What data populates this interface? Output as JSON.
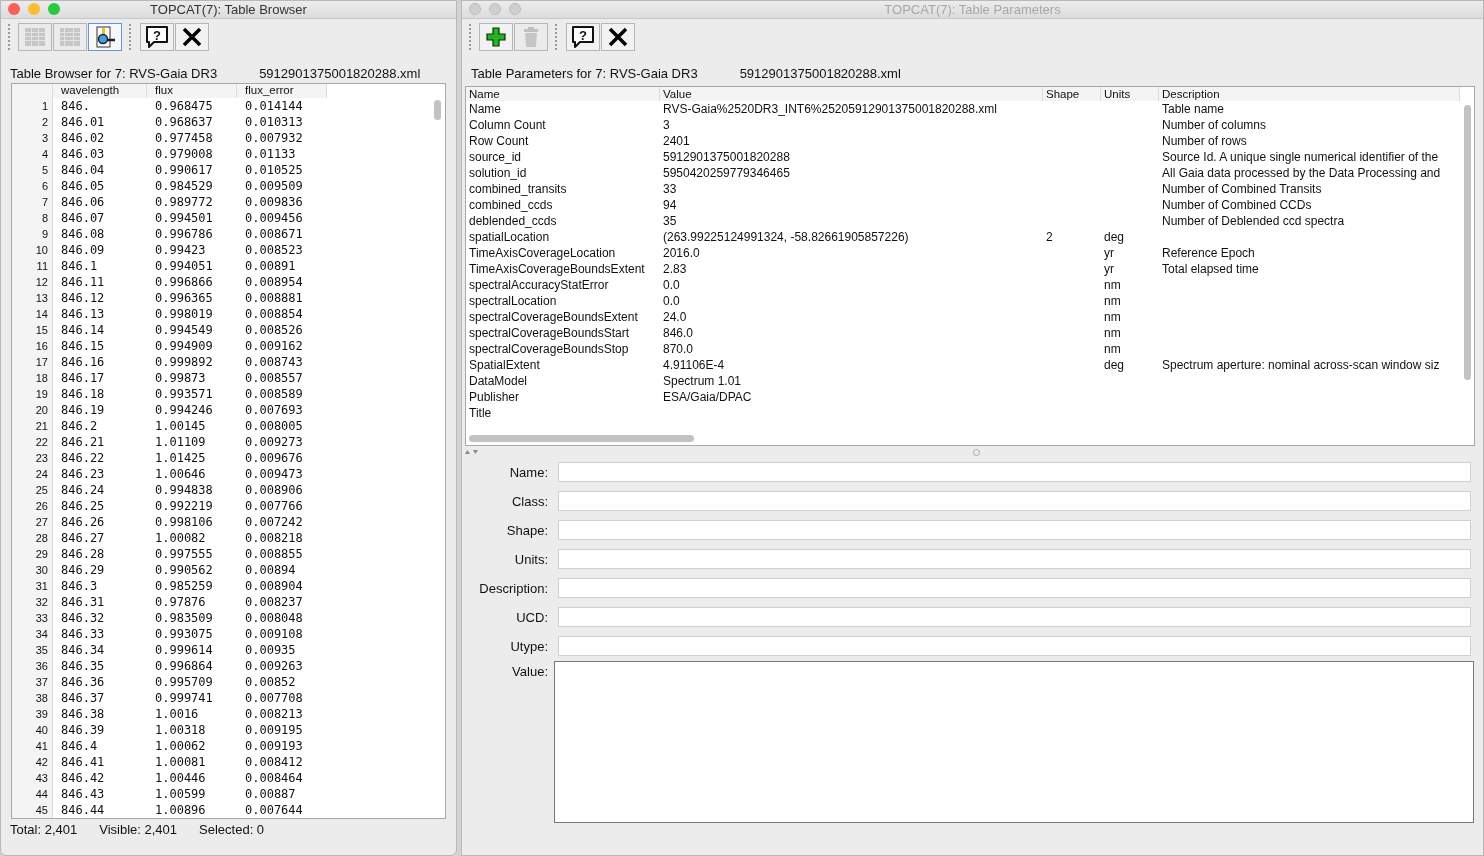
{
  "browser": {
    "window": {
      "title": "TOPCAT(7): Table Browser",
      "active": true
    },
    "toolbar": [
      [
        {
          "kind": "grid",
          "disabled": true,
          "selected": false
        },
        {
          "kind": "grid-alt",
          "disabled": true,
          "selected": false
        },
        {
          "kind": "search",
          "disabled": false,
          "selected": true
        }
      ],
      [
        {
          "kind": "help",
          "glyph": "?",
          "disabled": false,
          "selected": false
        },
        {
          "kind": "close",
          "disabled": false,
          "selected": false
        }
      ]
    ],
    "heading": "Table Browser for 7: RVS-Gaia DR3",
    "heading_file": "5912901375001820288.xml",
    "table": {
      "columns": [
        "",
        "wavelength",
        "flux",
        "flux_error"
      ],
      "rows": [
        [
          "1",
          "846.",
          "0.968475",
          "0.014144"
        ],
        [
          "2",
          "846.01",
          "0.968637",
          "0.010313"
        ],
        [
          "3",
          "846.02",
          "0.977458",
          "0.007932"
        ],
        [
          "4",
          "846.03",
          "0.979008",
          "0.01133"
        ],
        [
          "5",
          "846.04",
          "0.990617",
          "0.010525"
        ],
        [
          "6",
          "846.05",
          "0.984529",
          "0.009509"
        ],
        [
          "7",
          "846.06",
          "0.989772",
          "0.009836"
        ],
        [
          "8",
          "846.07",
          "0.994501",
          "0.009456"
        ],
        [
          "9",
          "846.08",
          "0.996786",
          "0.008671"
        ],
        [
          "10",
          "846.09",
          "0.99423",
          "0.008523"
        ],
        [
          "11",
          "846.1",
          "0.994051",
          "0.00891"
        ],
        [
          "12",
          "846.11",
          "0.996866",
          "0.008954"
        ],
        [
          "13",
          "846.12",
          "0.996365",
          "0.008881"
        ],
        [
          "14",
          "846.13",
          "0.998019",
          "0.008854"
        ],
        [
          "15",
          "846.14",
          "0.994549",
          "0.008526"
        ],
        [
          "16",
          "846.15",
          "0.994909",
          "0.009162"
        ],
        [
          "17",
          "846.16",
          "0.999892",
          "0.008743"
        ],
        [
          "18",
          "846.17",
          "0.99873",
          "0.008557"
        ],
        [
          "19",
          "846.18",
          "0.993571",
          "0.008589"
        ],
        [
          "20",
          "846.19",
          "0.994246",
          "0.007693"
        ],
        [
          "21",
          "846.2",
          "1.00145",
          "0.008005"
        ],
        [
          "22",
          "846.21",
          "1.01109",
          "0.009273"
        ],
        [
          "23",
          "846.22",
          "1.01425",
          "0.009676"
        ],
        [
          "24",
          "846.23",
          "1.00646",
          "0.009473"
        ],
        [
          "25",
          "846.24",
          "0.994838",
          "0.008906"
        ],
        [
          "26",
          "846.25",
          "0.992219",
          "0.007766"
        ],
        [
          "27",
          "846.26",
          "0.998106",
          "0.007242"
        ],
        [
          "28",
          "846.27",
          "1.00082",
          "0.008218"
        ],
        [
          "29",
          "846.28",
          "0.997555",
          "0.008855"
        ],
        [
          "30",
          "846.29",
          "0.990562",
          "0.00894"
        ],
        [
          "31",
          "846.3",
          "0.985259",
          "0.008904"
        ],
        [
          "32",
          "846.31",
          "0.97876",
          "0.008237"
        ],
        [
          "33",
          "846.32",
          "0.983509",
          "0.008048"
        ],
        [
          "34",
          "846.33",
          "0.993075",
          "0.009108"
        ],
        [
          "35",
          "846.34",
          "0.999614",
          "0.00935"
        ],
        [
          "36",
          "846.35",
          "0.996864",
          "0.009263"
        ],
        [
          "37",
          "846.36",
          "0.995709",
          "0.00852"
        ],
        [
          "38",
          "846.37",
          "0.999741",
          "0.007708"
        ],
        [
          "39",
          "846.38",
          "1.0016",
          "0.008213"
        ],
        [
          "40",
          "846.39",
          "1.00318",
          "0.009195"
        ],
        [
          "41",
          "846.4",
          "1.00062",
          "0.009193"
        ],
        [
          "42",
          "846.41",
          "1.00081",
          "0.008412"
        ],
        [
          "43",
          "846.42",
          "1.00446",
          "0.008464"
        ],
        [
          "44",
          "846.43",
          "1.00599",
          "0.00887"
        ],
        [
          "45",
          "846.44",
          "1.00896",
          "0.007644"
        ]
      ]
    },
    "status": [
      "Total: 2,401",
      "Visible: 2,401",
      "Selected: 0"
    ]
  },
  "parameters": {
    "window": {
      "title": "TOPCAT(7): Table Parameters",
      "active": false
    },
    "toolbar": [
      [
        {
          "kind": "add",
          "disabled": false
        },
        {
          "kind": "delete",
          "disabled": true
        }
      ],
      [
        {
          "kind": "help",
          "glyph": "?",
          "disabled": false
        },
        {
          "kind": "close",
          "disabled": false
        }
      ]
    ],
    "heading": "Table Parameters for 7: RVS-Gaia DR3",
    "heading_file": "5912901375001820288.xml",
    "table": {
      "columns": [
        "Name",
        "Value",
        "Shape",
        "Units",
        "Description"
      ],
      "rows": [
        [
          "Name",
          "RVS-Gaia%2520DR3_INT6%25205912901375001820288.xml",
          "",
          "",
          "Table name"
        ],
        [
          "Column Count",
          "3",
          "",
          "",
          "Number of columns"
        ],
        [
          "Row Count",
          "2401",
          "",
          "",
          "Number of rows"
        ],
        [
          "source_id",
          "5912901375001820288",
          "",
          "",
          "Source Id. A unique single numerical identifier of the"
        ],
        [
          "solution_id",
          "5950420259779346465",
          "",
          "",
          "All Gaia data processed by the Data Processing and"
        ],
        [
          "combined_transits",
          "33",
          "",
          "",
          "Number of Combined Transits"
        ],
        [
          "combined_ccds",
          "94",
          "",
          "",
          "Number of Combined CCDs"
        ],
        [
          "deblended_ccds",
          "35",
          "",
          "",
          "Number of Deblended ccd spectra"
        ],
        [
          "spatialLocation",
          "(263.99225124991324, -58.82661905857226)",
          "2",
          "deg",
          ""
        ],
        [
          "TimeAxisCoverageLocation",
          "2016.0",
          "",
          "yr",
          "Reference Epoch"
        ],
        [
          "TimeAxisCoverageBoundsExtent",
          "2.83",
          "",
          "yr",
          "Total elapsed time"
        ],
        [
          "spectralAccuracyStatError",
          "0.0",
          "",
          "nm",
          ""
        ],
        [
          "spectralLocation",
          "0.0",
          "",
          "nm",
          ""
        ],
        [
          "spectralCoverageBoundsExtent",
          "24.0",
          "",
          "nm",
          ""
        ],
        [
          "spectralCoverageBoundsStart",
          "846.0",
          "",
          "nm",
          ""
        ],
        [
          "spectralCoverageBoundsStop",
          "870.0",
          "",
          "nm",
          ""
        ],
        [
          "SpatialExtent",
          "4.91106E-4",
          "",
          "deg",
          "Spectrum aperture: nominal across-scan window siz"
        ],
        [
          "DataModel",
          "Spectrum 1.01",
          "",
          "",
          ""
        ],
        [
          "Publisher",
          "ESA/Gaia/DPAC",
          "",
          "",
          ""
        ],
        [
          "Title",
          "",
          "",
          "",
          ""
        ]
      ]
    },
    "form": {
      "fields": [
        "Name:",
        "Class:",
        "Shape:",
        "Units:",
        "Description:",
        "UCD:",
        "Utype:"
      ],
      "value_label": "Value:"
    }
  }
}
